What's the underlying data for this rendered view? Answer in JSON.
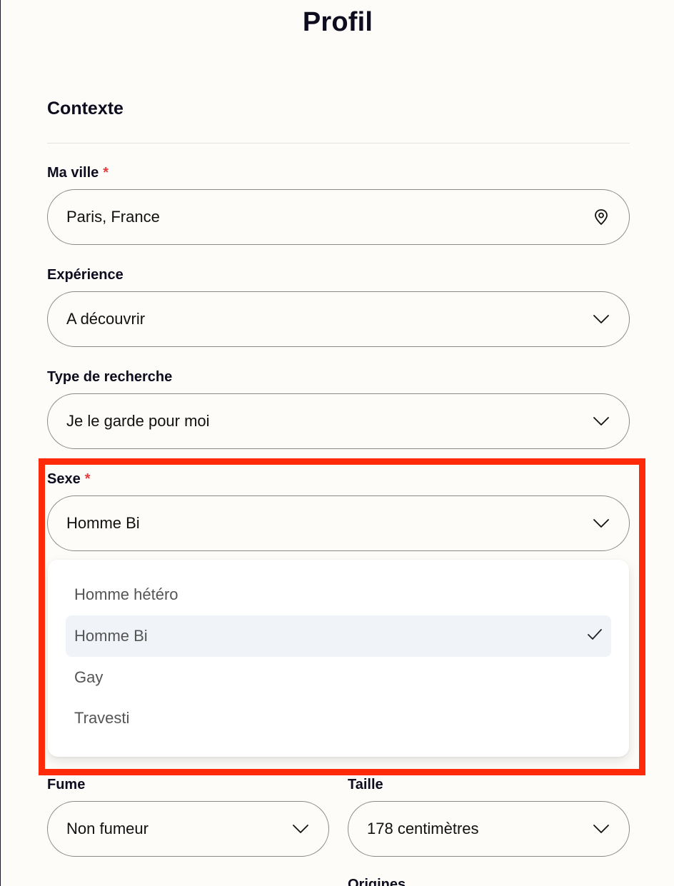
{
  "page": {
    "title": "Profil"
  },
  "section": {
    "title": "Contexte"
  },
  "required_mark": "*",
  "fields": {
    "city": {
      "label": "Ma ville",
      "value": "Paris, France",
      "icon": "location-pin-icon"
    },
    "experience": {
      "label": "Expérience",
      "value": "A découvrir",
      "icon": "chevron-down-icon"
    },
    "search_type": {
      "label": "Type de recherche",
      "value": "Je le garde pour moi",
      "icon": "chevron-down-icon"
    },
    "sex": {
      "label": "Sexe",
      "value": "Homme Bi",
      "icon": "chevron-down-icon"
    },
    "smoke": {
      "label": "Fume",
      "value": "Non fumeur",
      "icon": "chevron-down-icon"
    },
    "height": {
      "label": "Taille",
      "value": "178 centimètres",
      "icon": "chevron-down-icon"
    },
    "origins": {
      "label": "Origines"
    }
  },
  "sex_dropdown": {
    "options": [
      {
        "label": "Homme hétéro",
        "selected": false
      },
      {
        "label": "Homme Bi",
        "selected": true
      },
      {
        "label": "Gay",
        "selected": false
      },
      {
        "label": "Travesti",
        "selected": false
      }
    ],
    "check_icon": "checkmark-icon"
  },
  "colors": {
    "background": "#fdfcf8",
    "text": "#0d0d1f",
    "required": "#e63c3c",
    "highlight": "#ff2a0a",
    "selected_option_bg": "#f0f3f7"
  }
}
